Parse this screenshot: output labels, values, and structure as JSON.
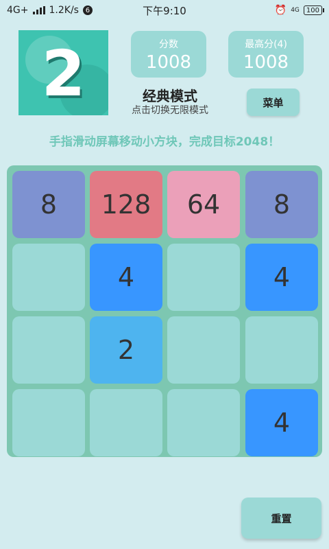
{
  "status_bar": {
    "network": "4G+",
    "speed": "1.2K/s",
    "badge": "6",
    "time": "下午9:10",
    "net_right": "4G",
    "battery": "100"
  },
  "logo": {
    "digit": "2"
  },
  "score": {
    "label": "分数",
    "value": "1008"
  },
  "best": {
    "label": "最高分(4)",
    "value": "1008"
  },
  "mode": {
    "title": "经典模式",
    "subtitle": "点击切换无限模式"
  },
  "menu_label": "菜单",
  "hint": "手指滑动屏幕移动小方块，完成目标2048！",
  "board": {
    "rows": [
      [
        "8",
        "128",
        "64",
        "8"
      ],
      [
        "",
        "4",
        "",
        "4"
      ],
      [
        "",
        "2",
        "",
        ""
      ],
      [
        "",
        "",
        "",
        "4"
      ]
    ]
  },
  "tile_colors": {
    "empty": "#9bd9d6",
    "2": "#4eb4ef",
    "4": "#3896ff",
    "8": "#7e92d1",
    "64": "#eba0b9",
    "128": "#e27a85"
  },
  "reset_label": "重置"
}
